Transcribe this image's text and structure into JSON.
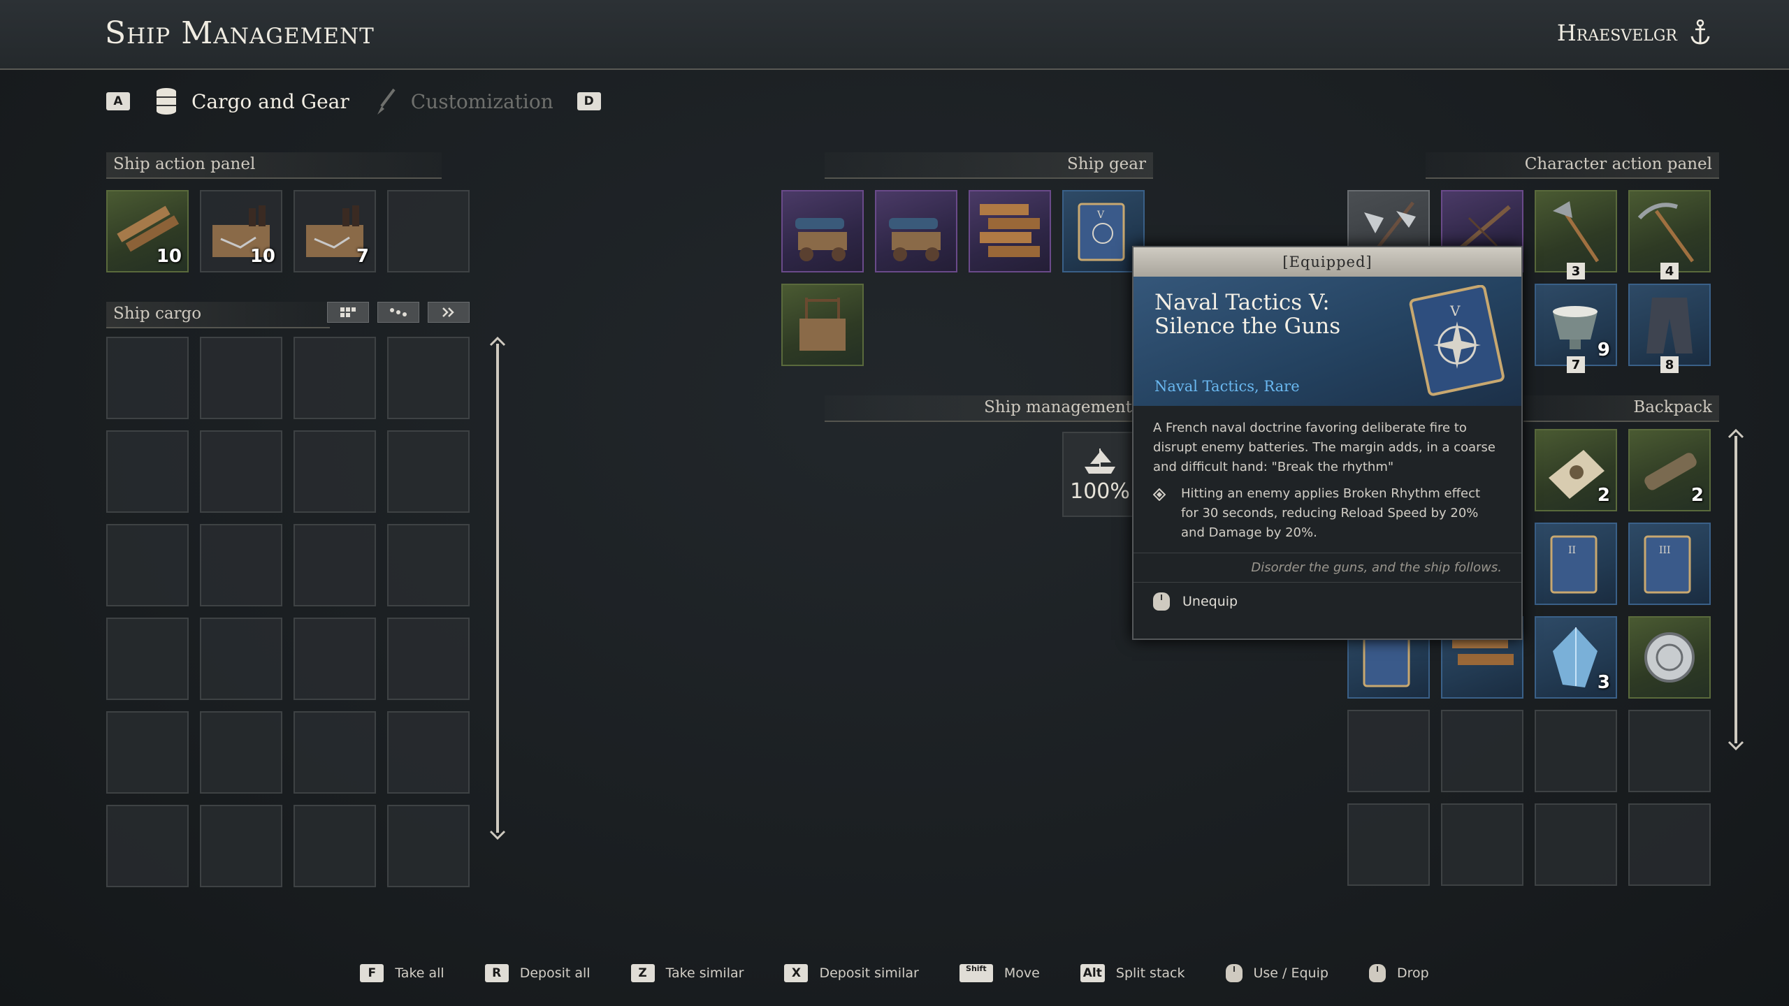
{
  "header": {
    "title": "Ship Management",
    "ship_name": "Hraesvelgr"
  },
  "tabs": {
    "prev_key": "A",
    "next_key": "D",
    "items": [
      {
        "label": "Cargo and Gear",
        "icon": "barrel-icon",
        "active": true
      },
      {
        "label": "Customization",
        "icon": "brush-icon",
        "active": false
      }
    ]
  },
  "sections": {
    "ship_action_panel": "Ship action panel",
    "ship_cargo": "Ship cargo",
    "ship_gear": "Ship gear",
    "ship_management": "Ship management",
    "character_action_panel": "Character action panel",
    "backpack": "Backpack"
  },
  "ship_action_items": [
    {
      "icon": "planks-icon",
      "count": "10",
      "rarity": "green"
    },
    {
      "icon": "repair-kit-icon",
      "count": "10",
      "rarity": "plain"
    },
    {
      "icon": "repair-kit-icon",
      "count": "7",
      "rarity": "plain"
    },
    {
      "icon": "",
      "count": "",
      "rarity": "empty"
    }
  ],
  "cargo_filters": [
    "grid-icon",
    "sort-icon",
    "transfer-icon"
  ],
  "ship_gear": [
    {
      "icon": "cannon-icon",
      "rarity": "purple"
    },
    {
      "icon": "cannon-icon",
      "rarity": "purple"
    },
    {
      "icon": "hull-planks-icon",
      "rarity": "purple"
    },
    {
      "icon": "tactics-book-icon",
      "rarity": "blue"
    },
    {
      "icon": "rack-icon",
      "rarity": "green"
    }
  ],
  "ship_management": {
    "value": "100%"
  },
  "character_actions": [
    {
      "icon": "halberd-icon",
      "badge": "",
      "rarity": "grey"
    },
    {
      "icon": "crossbow-icon",
      "badge": "",
      "rarity": "purple"
    },
    {
      "icon": "axe-icon",
      "badge": "3",
      "rarity": "green"
    },
    {
      "icon": "pickaxe-icon",
      "badge": "4",
      "rarity": "green"
    },
    {
      "icon": "bowl-icon",
      "badge": "7",
      "count": "9",
      "rarity": "blue"
    },
    {
      "icon": "trousers-icon",
      "badge": "8",
      "rarity": "blue"
    }
  ],
  "backpack": [
    {
      "icon": "herbs-icon",
      "count": "2",
      "rarity": "green"
    },
    {
      "icon": "wood-icon",
      "count": "2",
      "rarity": "green"
    },
    {
      "icon": "book-ii-icon",
      "count": "",
      "rarity": "blue"
    },
    {
      "icon": "book-iii-icon",
      "count": "",
      "rarity": "blue"
    },
    {
      "icon": "book-icon",
      "count": "",
      "rarity": "blue"
    },
    {
      "icon": "planks-icon",
      "count": "",
      "rarity": "blue"
    },
    {
      "icon": "crystal-icon",
      "count": "3",
      "rarity": "blue"
    },
    {
      "icon": "medallion-icon",
      "count": "",
      "rarity": "green"
    }
  ],
  "tooltip": {
    "status": "[Equipped]",
    "name": "Naval Tactics V: Silence the Guns",
    "subtitle": "Naval Tactics, Rare",
    "description": "A French naval doctrine favoring deliberate fire to disrupt enemy batteries. The margin adds, in a coarse and difficult hand: \"Break the rhythm\"",
    "effect": "Hitting an enemy applies Broken Rhythm effect for 30 seconds, reducing Reload Speed by 20% and Damage by 20%.",
    "quote": "Disorder the guns, and the ship follows.",
    "action": "Unequip"
  },
  "footer": [
    {
      "key": "F",
      "label": "Take all"
    },
    {
      "key": "R",
      "label": "Deposit all"
    },
    {
      "key": "Z",
      "label": "Take similar"
    },
    {
      "key": "X",
      "label": "Deposit similar"
    },
    {
      "key": "Shift",
      "label": "Move"
    },
    {
      "key": "Alt",
      "label": "Split stack"
    },
    {
      "key": "mouse",
      "label": "Use / Equip"
    },
    {
      "key": "mouse",
      "label": "Drop"
    }
  ],
  "colors": {
    "green": "#5a6a3c",
    "purple": "#6a4a8a",
    "blue": "#3a6088",
    "accent_blue": "#6ab8f0"
  }
}
